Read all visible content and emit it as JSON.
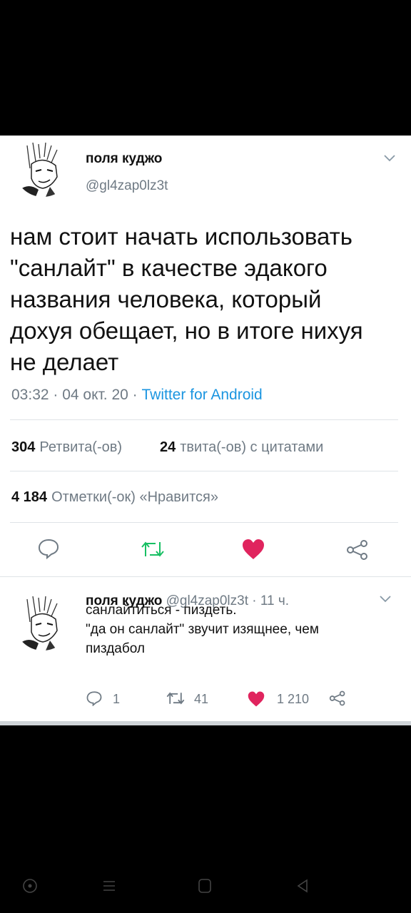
{
  "tweet": {
    "author_name": "поля куджо",
    "author_handle": "@gl4zap0lz3t",
    "text": "нам стоит начать использовать\n\"санлайт\" в качестве эдакого\nназвания человека, который\nдохуя обещает, но в итоге нихуя\nне делает",
    "time": "03:32 · 04 окт. 20 · ",
    "source": "Twitter for Android",
    "retweets_count": "304",
    "retweets_label": "Ретвита(-ов)",
    "quotes_count": "24",
    "quotes_label": "твита(-ов) с цитатами",
    "likes_count": "4 184",
    "likes_label": "Отметки(-ок) «Нравится»",
    "liked": true,
    "like_color": "#e0245e"
  },
  "reply": {
    "author_name": "поля куджо",
    "author_handle": "@gl4zap0lz3t",
    "time": " · 11 ч.",
    "text": "санлайтиться - пиздеть.\n\"да он санлайт\" звучит изящнее, чем\nпиздабол",
    "reply_count": "1",
    "retweet_count": "41",
    "like_count": "1 210"
  },
  "icons": {
    "reply": "reply-icon",
    "retweet": "retweet-icon",
    "like": "heart-icon",
    "share": "share-icon",
    "menu": "chevron-down-icon"
  },
  "colors": {
    "retweet_accent": "#17bf63",
    "link": "#1b95e0"
  }
}
